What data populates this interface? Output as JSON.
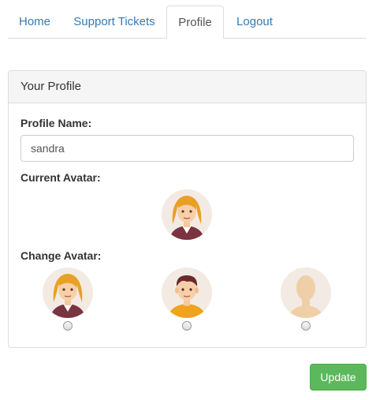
{
  "nav": {
    "tabs": [
      {
        "label": "Home",
        "active": false
      },
      {
        "label": "Support Tickets",
        "active": false
      },
      {
        "label": "Profile",
        "active": true
      },
      {
        "label": "Logout",
        "active": false
      }
    ]
  },
  "panel": {
    "heading": "Your Profile",
    "profile_name_label": "Profile Name:",
    "profile_name_value": "sandra",
    "current_avatar_label": "Current Avatar:",
    "current_avatar": "female-avatar",
    "change_avatar_label": "Change Avatar:",
    "avatar_options": [
      {
        "icon": "female-avatar",
        "selected": false
      },
      {
        "icon": "male-avatar",
        "selected": false
      },
      {
        "icon": "blank-avatar",
        "selected": false
      }
    ]
  },
  "actions": {
    "update_label": "Update"
  },
  "colors": {
    "link": "#337ab7",
    "success": "#5cb85c",
    "panel_heading_bg": "#f5f5f5"
  }
}
